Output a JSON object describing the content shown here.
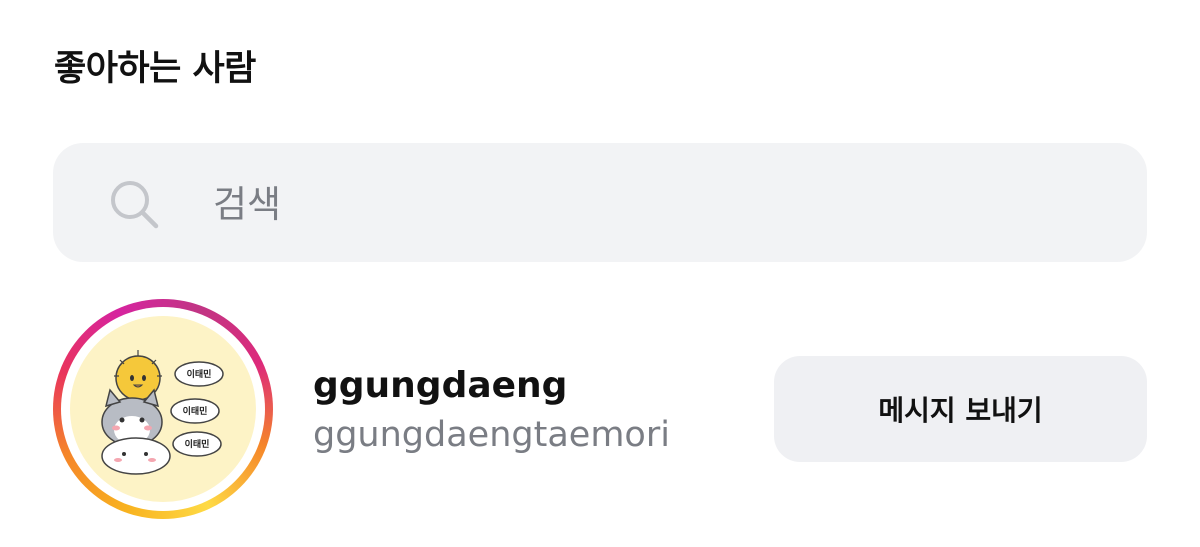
{
  "header": {
    "title": "좋아하는 사람"
  },
  "search": {
    "placeholder": "검색",
    "icon": "search-icon"
  },
  "user": {
    "username": "ggungdaeng",
    "full_name": "ggungdaengtaemori",
    "avatar_bubble_text": "이태민",
    "avatar_icon": "avatar-sticker-image",
    "message_button_label": "메시지 보내기"
  },
  "colors": {
    "ring_gradient": [
      "#feda45",
      "#f58529",
      "#dd2a7b",
      "#c13584"
    ],
    "search_bg": "#f2f3f5",
    "button_bg": "#eff0f3",
    "secondary_text": "#7a7d84"
  }
}
